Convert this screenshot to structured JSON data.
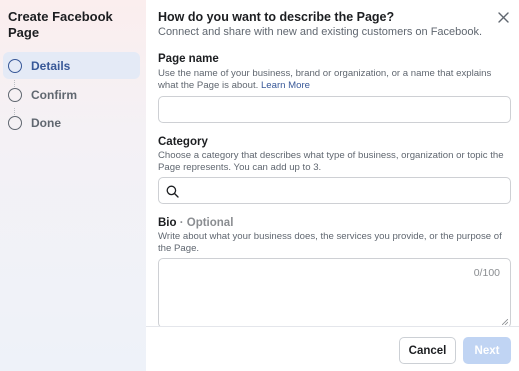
{
  "sidebar": {
    "title": "Create Facebook Page",
    "steps": [
      {
        "label": "Details",
        "active": true
      },
      {
        "label": "Confirm",
        "active": false
      },
      {
        "label": "Done",
        "active": false
      }
    ]
  },
  "header": {
    "title": "How do you want to describe the Page?",
    "subtitle": "Connect and share with new and existing customers on Facebook."
  },
  "fields": {
    "page_name": {
      "label": "Page name",
      "help": "Use the name of your business, brand or organization, or a name that explains what the Page is about.",
      "link": "Learn More",
      "value": ""
    },
    "category": {
      "label": "Category",
      "help": "Choose a category that describes what type of business, organization or topic the Page represents. You can add up to 3.",
      "value": ""
    },
    "bio": {
      "label": "Bio",
      "optional": "· Optional",
      "help": "Write about what your business does, the services you provide, or the purpose of the Page.",
      "counter": "0/100",
      "value": ""
    }
  },
  "footer": {
    "cancel": "Cancel",
    "next": "Next"
  },
  "colors": {
    "accent": "#385898",
    "next_disabled": "#c0d4f3",
    "border": "#ced0d4"
  },
  "icons": {
    "close": "close-icon",
    "search": "search-icon",
    "step": "step-circle-icon"
  }
}
